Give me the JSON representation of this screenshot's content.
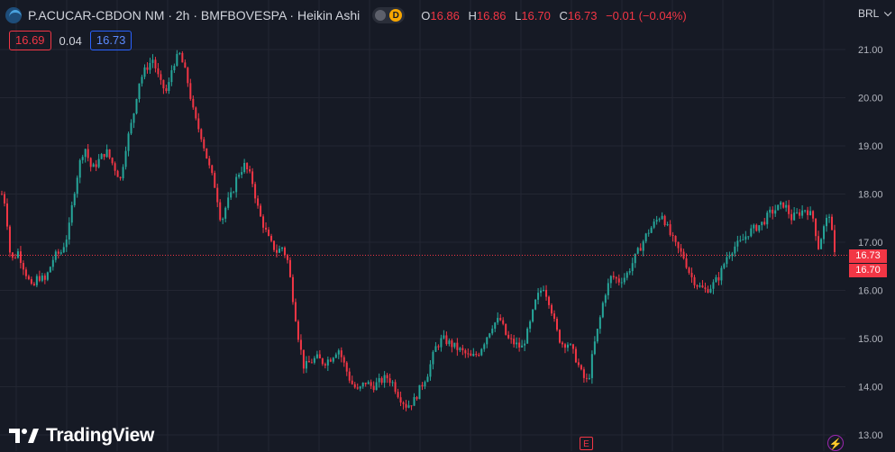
{
  "header": {
    "symbol_title": "P.ACUCAR-CBDON NM · 2h · BMFBOVESPA · Heikin Ashi",
    "indicator_badge": "D",
    "ohlc": {
      "o_label": "O",
      "o_value": "16.86",
      "h_label": "H",
      "h_value": "16.86",
      "l_label": "L",
      "l_value": "16.70",
      "c_label": "C",
      "c_value": "16.73",
      "change": "−0.01 (−0.04%)"
    }
  },
  "trade": {
    "sell_price": "16.69",
    "spread": "0.04",
    "buy_price": "16.73"
  },
  "currency": "BRL",
  "price_tags": {
    "last": "16.73",
    "close": "16.70"
  },
  "branding": {
    "logo_text": "TradingView"
  },
  "markers": {
    "earnings_label": "E"
  },
  "colors": {
    "background": "#161a25",
    "up": "#26a69a",
    "down": "#f23645",
    "grid": "#232632",
    "axis_text": "#b2b5be",
    "price_line": "#f23645"
  },
  "chart_data": {
    "type": "candlestick",
    "chart_style": "Heikin Ashi",
    "interval": "2h",
    "ylim": [
      13.0,
      21.2
    ],
    "y_ticks": [
      "21.00",
      "20.00",
      "19.00",
      "18.00",
      "17.00",
      "16.00",
      "15.00",
      "14.00",
      "13.00"
    ],
    "axis_position": "right",
    "grid": true,
    "last_price": 16.73,
    "close": 16.7,
    "path": [
      [
        0,
        18.0
      ],
      [
        4,
        17.8
      ],
      [
        10,
        16.6
      ],
      [
        18,
        16.8
      ],
      [
        26,
        16.4
      ],
      [
        34,
        16.0
      ],
      [
        40,
        16.3
      ],
      [
        48,
        16.2
      ],
      [
        58,
        16.7
      ],
      [
        66,
        16.8
      ],
      [
        74,
        17.2
      ],
      [
        80,
        18.0
      ],
      [
        86,
        18.6
      ],
      [
        92,
        19.0
      ],
      [
        100,
        18.5
      ],
      [
        108,
        18.7
      ],
      [
        116,
        18.9
      ],
      [
        124,
        18.6
      ],
      [
        132,
        18.3
      ],
      [
        138,
        19.0
      ],
      [
        146,
        19.6
      ],
      [
        152,
        20.3
      ],
      [
        160,
        20.6
      ],
      [
        168,
        20.8
      ],
      [
        176,
        20.3
      ],
      [
        184,
        20.1
      ],
      [
        190,
        20.7
      ],
      [
        198,
        20.9
      ],
      [
        206,
        20.4
      ],
      [
        214,
        19.6
      ],
      [
        222,
        19.2
      ],
      [
        230,
        18.6
      ],
      [
        238,
        18.1
      ],
      [
        244,
        17.4
      ],
      [
        250,
        17.8
      ],
      [
        256,
        18.0
      ],
      [
        262,
        18.4
      ],
      [
        270,
        18.6
      ],
      [
        278,
        18.3
      ],
      [
        286,
        17.6
      ],
      [
        292,
        17.3
      ],
      [
        298,
        17.0
      ],
      [
        306,
        16.8
      ],
      [
        312,
        16.9
      ],
      [
        318,
        16.6
      ],
      [
        324,
        15.8
      ],
      [
        330,
        15.0
      ],
      [
        336,
        14.4
      ],
      [
        342,
        14.5
      ],
      [
        350,
        14.6
      ],
      [
        358,
        14.5
      ],
      [
        366,
        14.6
      ],
      [
        374,
        14.8
      ],
      [
        380,
        14.5
      ],
      [
        388,
        14.1
      ],
      [
        396,
        13.9
      ],
      [
        404,
        14.1
      ],
      [
        412,
        14.0
      ],
      [
        420,
        14.1
      ],
      [
        428,
        14.2
      ],
      [
        434,
        14.1
      ],
      [
        442,
        13.8
      ],
      [
        450,
        13.6
      ],
      [
        458,
        13.7
      ],
      [
        466,
        14.0
      ],
      [
        474,
        14.3
      ],
      [
        482,
        14.8
      ],
      [
        490,
        15.0
      ],
      [
        498,
        14.9
      ],
      [
        506,
        14.8
      ],
      [
        514,
        14.7
      ],
      [
        522,
        14.6
      ],
      [
        530,
        14.7
      ],
      [
        538,
        15.0
      ],
      [
        546,
        15.3
      ],
      [
        554,
        15.4
      ],
      [
        562,
        15.0
      ],
      [
        570,
        14.9
      ],
      [
        578,
        14.8
      ],
      [
        586,
        15.2
      ],
      [
        594,
        15.8
      ],
      [
        602,
        16.1
      ],
      [
        610,
        15.7
      ],
      [
        616,
        15.2
      ],
      [
        622,
        14.9
      ],
      [
        630,
        14.9
      ],
      [
        638,
        14.6
      ],
      [
        646,
        14.2
      ],
      [
        652,
        14.1
      ],
      [
        658,
        14.8
      ],
      [
        664,
        15.3
      ],
      [
        670,
        15.9
      ],
      [
        678,
        16.3
      ],
      [
        686,
        16.2
      ],
      [
        694,
        16.3
      ],
      [
        702,
        16.6
      ],
      [
        710,
        16.9
      ],
      [
        718,
        17.2
      ],
      [
        726,
        17.4
      ],
      [
        734,
        17.6
      ],
      [
        742,
        17.2
      ],
      [
        750,
        16.9
      ],
      [
        758,
        16.7
      ],
      [
        766,
        16.3
      ],
      [
        774,
        16.1
      ],
      [
        782,
        16.0
      ],
      [
        790,
        16.1
      ],
      [
        798,
        16.3
      ],
      [
        806,
        16.7
      ],
      [
        814,
        16.9
      ],
      [
        822,
        17.0
      ],
      [
        830,
        17.2
      ],
      [
        838,
        17.3
      ],
      [
        846,
        17.4
      ],
      [
        854,
        17.6
      ],
      [
        862,
        17.7
      ],
      [
        870,
        17.8
      ],
      [
        878,
        17.5
      ],
      [
        886,
        17.6
      ],
      [
        894,
        17.7
      ],
      [
        902,
        17.5
      ],
      [
        908,
        16.9
      ],
      [
        914,
        17.3
      ],
      [
        920,
        17.6
      ],
      [
        926,
        16.73
      ]
    ]
  }
}
